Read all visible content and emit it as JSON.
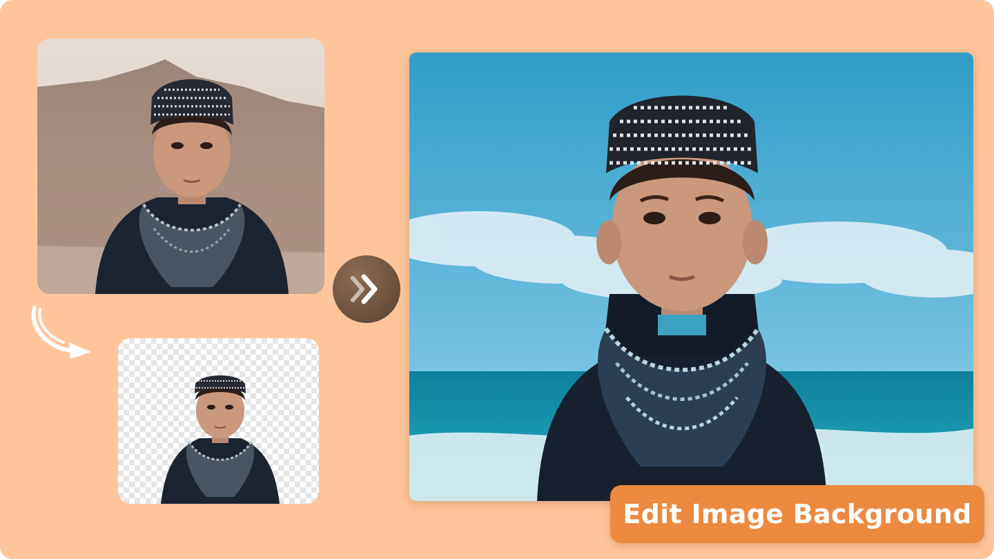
{
  "badge": {
    "label": "Edit Image Background"
  },
  "panels": {
    "original": {
      "scene": "mountain"
    },
    "cutout": {
      "scene": "transparent"
    },
    "result": {
      "scene": "beach"
    }
  },
  "icons": {
    "next": "double-chevron-right-icon",
    "curve": "curved-arrow-icon"
  },
  "colors": {
    "background": "#ffc59a",
    "badge": "#ec8a3f",
    "button": "#6a4c3a",
    "sky": "#3ea6cf",
    "sea": "#1aa3b8"
  }
}
